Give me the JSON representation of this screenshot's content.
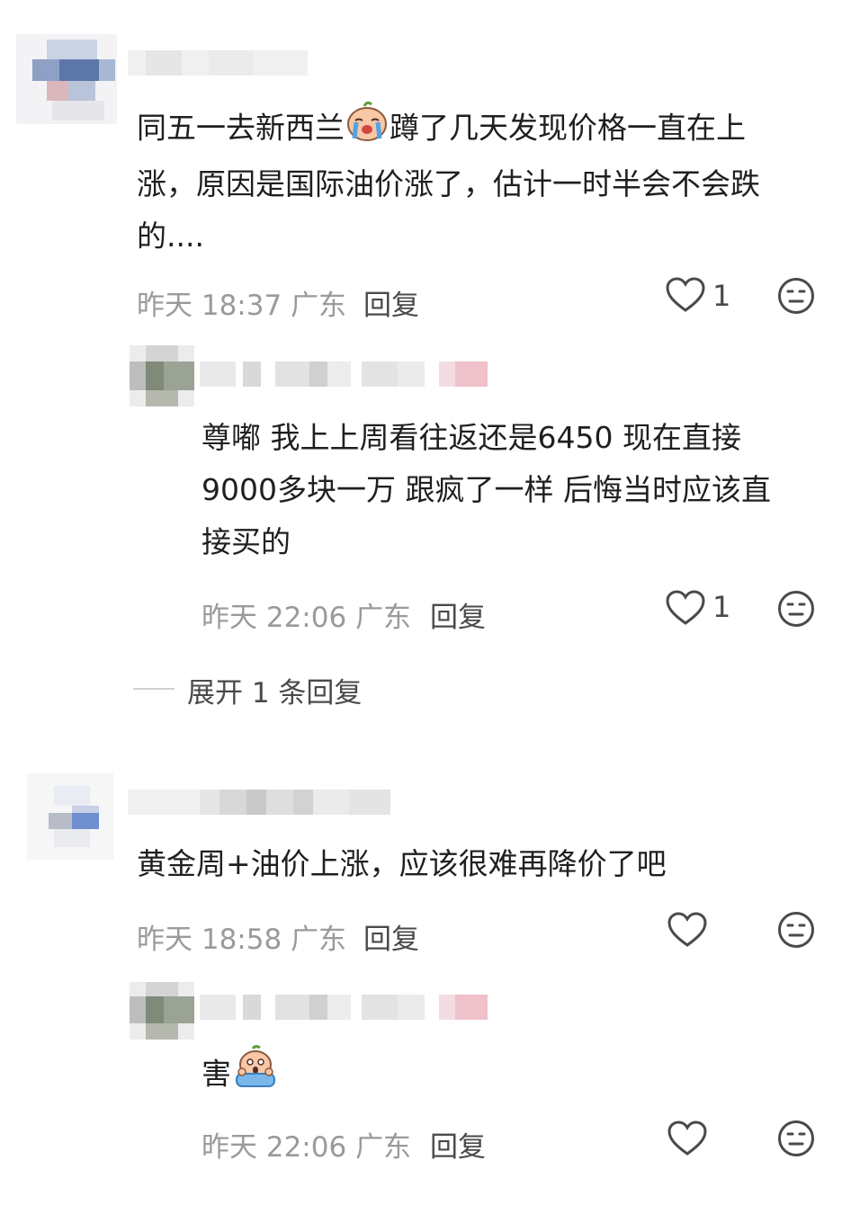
{
  "comments": [
    {
      "text_line1": "同五一去新西兰",
      "text_line1b": "蹲了几天发现价格一直在上",
      "text_line2": "涨，原因是国际油价涨了，估计一时半会不会跌",
      "text_line3": "的....",
      "emoji": "crying-emoji",
      "time": "昨天 18:37",
      "location": "广东",
      "reply_label": "回复",
      "like_count": "1",
      "replies": [
        {
          "text_line1": "尊嘟 我上上周看往返还是6450 现在直接",
          "text_line2": "9000多块一万 跟疯了一样 后悔当时应该直",
          "text_line3": "接买的",
          "time": "昨天 22:06",
          "location": "广东",
          "reply_label": "回复",
          "like_count": "1"
        }
      ],
      "expand_label": "展开 1 条回复"
    },
    {
      "text_line1": "黄金周+油价上涨，应该很难再降价了吧",
      "time": "昨天 18:58",
      "location": "广东",
      "reply_label": "回复",
      "like_count": "",
      "replies": [
        {
          "text_line1": "害",
          "emoji": "scared-emoji",
          "time": "昨天 22:06",
          "location": "广东",
          "reply_label": "回复",
          "like_count": ""
        }
      ]
    }
  ],
  "icons": {
    "like": "heart-outline-icon",
    "dislike": "neutral-face-icon"
  },
  "colors": {
    "text": "#1f1f1f",
    "meta": "#9a9a9a",
    "action": "#4a4a4a",
    "background": "#ffffff"
  }
}
